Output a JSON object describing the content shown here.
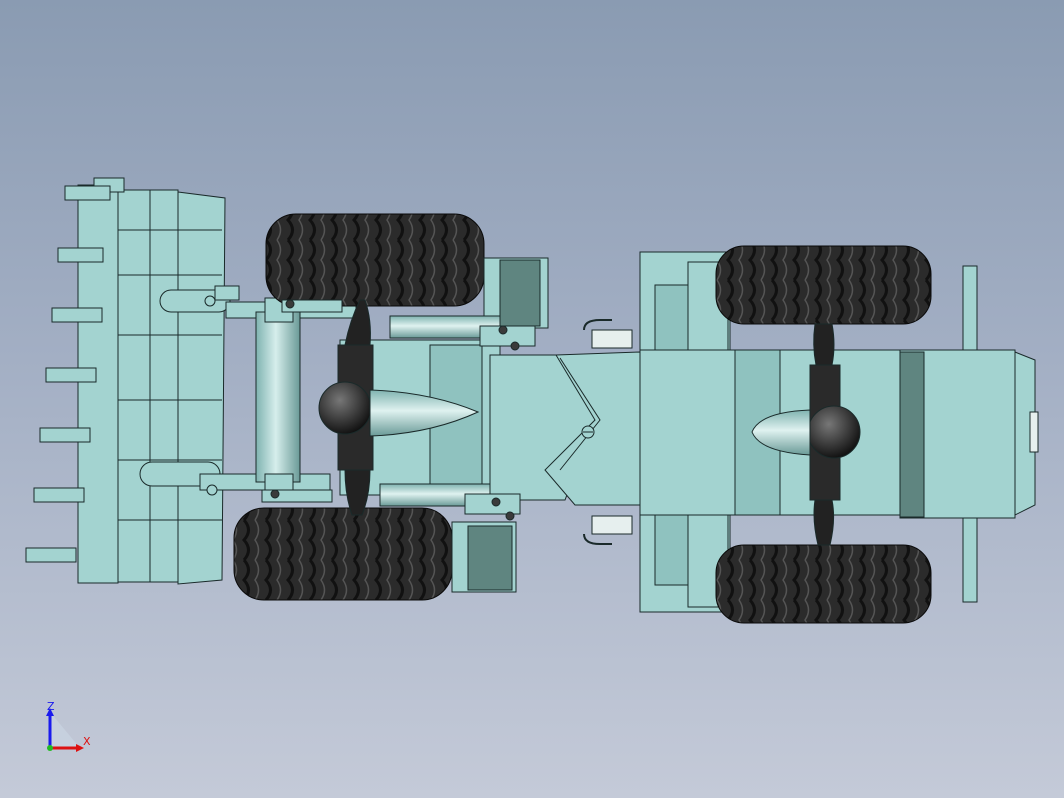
{
  "viewport": {
    "background_top": "#8a9bb2",
    "background_bottom": "#c4cad8",
    "model_color": "#a3d3d0",
    "model_dark_color": "#5f8580",
    "tire_color": "#2a2a2a",
    "edge_color": "#1a2a2a"
  },
  "triad": {
    "z_label": "Z",
    "x_label": "X",
    "z_color": "#1a1aee",
    "x_color": "#dd1111"
  }
}
